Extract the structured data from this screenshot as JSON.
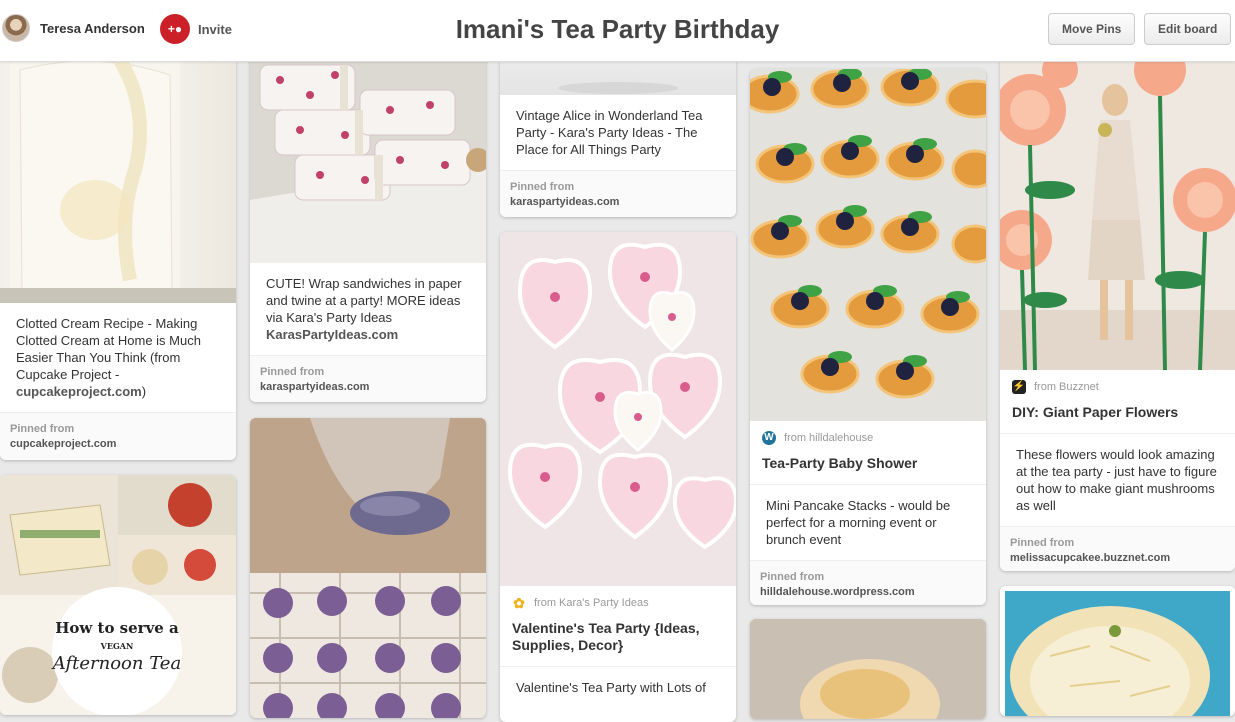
{
  "header": {
    "username": "Teresa Anderson",
    "invite_label": "Invite",
    "board_title": "Imani's Tea Party Birthday",
    "move_pins_label": "Move Pins",
    "edit_board_label": "Edit board"
  },
  "pinned_label": "Pinned from",
  "pins": {
    "clotted": {
      "description": "Clotted Cream Recipe - Making Clotted Cream at Home is Much Easier Than You Think (from Cupcake Project - ",
      "link": "cupcakeproject.com",
      "description_end": ")",
      "pinned_domain": "cupcakeproject.com"
    },
    "afternoon_tea": {
      "line1": "How to serve a",
      "line2": "VEGAN",
      "line3": "Afternoon Tea"
    },
    "sandwiches": {
      "description": "CUTE! Wrap sandwiches in paper and twine at a party! MORE ideas via Kara's Party Ideas ",
      "link": "KarasPartyIdeas.com",
      "pinned_domain": "karaspartyideas.com"
    },
    "alice": {
      "description": "Vintage Alice in Wonderland Tea Party - Kara's Party Ideas - The Place for All Things Party",
      "pinned_domain": "karaspartyideas.com"
    },
    "valentine": {
      "source": "from Kara's Party Ideas",
      "title": "Valentine's Tea Party {Ideas, Supplies, Decor}",
      "description": "Valentine's Tea Party with Lots of"
    },
    "pancakes": {
      "source": "from hilldalehouse",
      "title": "Tea-Party Baby Shower",
      "description": "Mini Pancake Stacks - would be perfect for a morning event or brunch event",
      "pinned_domain": "hilldalehouse.wordpress.com"
    },
    "flowers": {
      "source": "from Buzznet",
      "title": "DIY: Giant Paper Flowers",
      "description": "These flowers would look amazing at the tea party - just have to figure out how to make giant mushrooms as well",
      "pinned_domain": "melissacupcakee.buzznet.com"
    }
  },
  "colors": {
    "accent_red": "#cb2027",
    "background": "#e9e9e9"
  }
}
